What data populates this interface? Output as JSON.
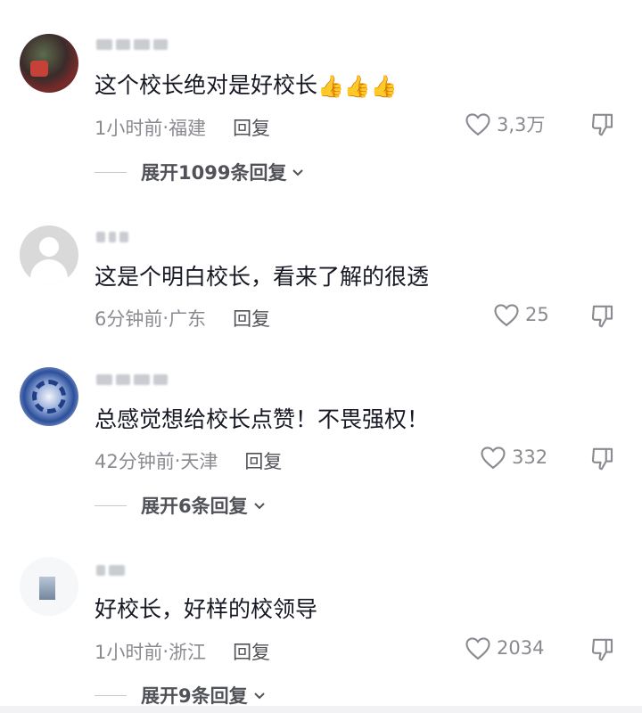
{
  "comments": [
    {
      "text": "这个校长绝对是好校长",
      "emoji": "👍👍👍",
      "time": "1小时前",
      "location": "福建",
      "reply_label": "回复",
      "likes": "3,3万",
      "expand_label": "展开1099条回复"
    },
    {
      "text": "这是个明白校长，看来了解的很透",
      "time": "6分钟前",
      "location": "广东",
      "reply_label": "回复",
      "likes": "25"
    },
    {
      "text": "总感觉想给校长点赞！不畏强权！",
      "time": "42分钟前",
      "location": "天津",
      "reply_label": "回复",
      "likes": "332",
      "expand_label": "展开6条回复"
    },
    {
      "text": "好校长，好样的校领导",
      "time": "1小时前",
      "location": "浙江",
      "reply_label": "回复",
      "likes": "2034",
      "expand_label": "展开9条回复"
    }
  ],
  "separator": " · ",
  "colors": {
    "text_primary": "#161823",
    "text_secondary": "#8a8b91",
    "reply": "#515258"
  },
  "icons": {
    "like": "heart-outline-icon",
    "dislike": "thumbs-down-icon",
    "expand": "chevron-down-icon"
  }
}
